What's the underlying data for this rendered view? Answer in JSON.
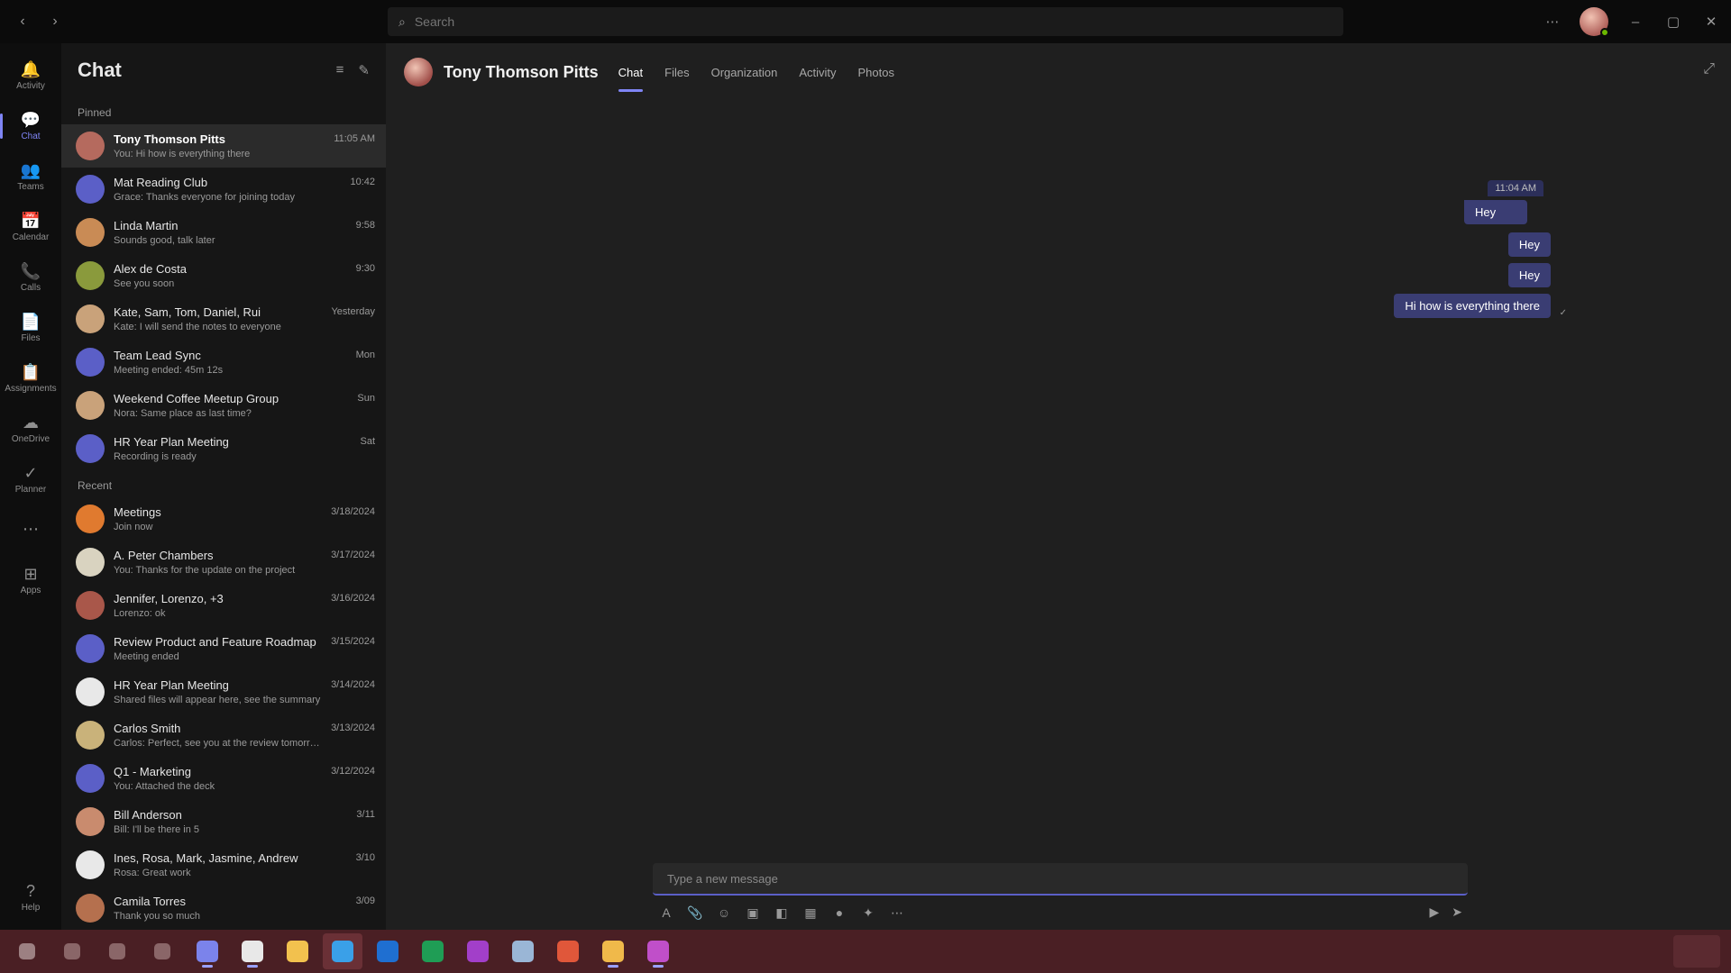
{
  "search": {
    "placeholder": "Search"
  },
  "rail": {
    "items": [
      {
        "name": "activity",
        "label": "Activity",
        "glyph": "🔔"
      },
      {
        "name": "chat",
        "label": "Chat",
        "glyph": "💬",
        "active": true
      },
      {
        "name": "teams",
        "label": "Teams",
        "glyph": "👥"
      },
      {
        "name": "calendar",
        "label": "Calendar",
        "glyph": "📅"
      },
      {
        "name": "calls",
        "label": "Calls",
        "glyph": "📞"
      },
      {
        "name": "files",
        "label": "Files",
        "glyph": "📄"
      },
      {
        "name": "assignments",
        "label": "Assignments",
        "glyph": "📋"
      },
      {
        "name": "onedrive",
        "label": "OneDrive",
        "glyph": "☁"
      },
      {
        "name": "planner",
        "label": "Planner",
        "glyph": "✓"
      },
      {
        "name": "more",
        "label": "",
        "glyph": "⋯"
      },
      {
        "name": "apps",
        "label": "Apps",
        "glyph": "⊞"
      }
    ],
    "help": {
      "label": "Help",
      "glyph": "?"
    }
  },
  "chatlist": {
    "title": "Chat",
    "pinned_label": "Pinned",
    "recent_label": "Recent",
    "pinned": [
      {
        "name": "Tony Thomson Pitts",
        "preview": "You: Hi how is everything there",
        "time": "11:05 AM",
        "color": "#b56a5e",
        "bold": true,
        "selected": true
      },
      {
        "name": "Mat Reading Club",
        "preview": "Grace: Thanks everyone for joining today",
        "time": "10:42",
        "color": "#5b5fc7",
        "bold": false
      },
      {
        "name": "Linda Martin",
        "preview": "Sounds good, talk later",
        "time": "9:58",
        "color": "#c98b55",
        "bold": false
      },
      {
        "name": "Alex de Costa",
        "preview": "See you soon",
        "time": "9:30",
        "color": "#8a9a3c",
        "bold": false
      },
      {
        "name": "Kate, Sam, Tom, Daniel, Rui",
        "preview": "Kate: I will send the notes to everyone",
        "time": "Yesterday",
        "color": "#c9a27a",
        "bold": false
      },
      {
        "name": "Team Lead Sync",
        "preview": "Meeting ended: 45m 12s",
        "time": "Mon",
        "color": "#5b5fc7",
        "bold": false
      },
      {
        "name": "Weekend Coffee Meetup Group",
        "preview": "Nora: Same place as last time?",
        "time": "Sun",
        "color": "#c9a27a",
        "bold": false
      },
      {
        "name": "HR Year Plan Meeting",
        "preview": "Recording is ready",
        "time": "Sat",
        "color": "#5b5fc7",
        "bold": false
      }
    ],
    "recent": [
      {
        "name": "Meetings",
        "preview": "Join now",
        "time": "3/18/2024",
        "color": "#e07a2f",
        "bold": false
      },
      {
        "name": "A. Peter Chambers",
        "preview": "You: Thanks for the update on the project",
        "time": "3/17/2024",
        "color": "#d9d3c0",
        "bold": false
      },
      {
        "name": "Jennifer, Lorenzo, +3",
        "preview": "Lorenzo: ok",
        "time": "3/16/2024",
        "color": "#a9574a",
        "bold": false
      },
      {
        "name": "Review Product and Feature Roadmap",
        "preview": "Meeting ended",
        "time": "3/15/2024",
        "color": "#5b5fc7",
        "bold": false
      },
      {
        "name": "HR Year Plan Meeting",
        "preview": "Shared files will appear here, see the summary",
        "time": "3/14/2024",
        "color": "#e8e8e8",
        "bold": false
      },
      {
        "name": "Carlos Smith",
        "preview": "Carlos: Perfect, see you at the review tomorrow",
        "time": "3/13/2024",
        "color": "#c9b27a",
        "bold": false
      },
      {
        "name": "Q1 - Marketing",
        "preview": "You: Attached the deck",
        "time": "3/12/2024",
        "color": "#5b5fc7",
        "bold": false
      },
      {
        "name": "Bill Anderson",
        "preview": "Bill: I'll be there in 5",
        "time": "3/11",
        "color": "#c98b6e",
        "bold": false
      },
      {
        "name": "Ines, Rosa, Mark, Jasmine, Andrew",
        "preview": "Rosa: Great work",
        "time": "3/10",
        "color": "#e8e8e8",
        "bold": false
      },
      {
        "name": "Camila Torres",
        "preview": "Thank you so much",
        "time": "3/09",
        "color": "#b5704e",
        "bold": false
      }
    ]
  },
  "conversation": {
    "name": "Tony Thomson Pitts",
    "tabs": [
      "Chat",
      "Files",
      "Organization",
      "Activity",
      "Photos"
    ],
    "active_tab": "Chat",
    "meta": "11:04 AM",
    "messages": [
      "Hey",
      "Hey",
      "Hey",
      "Hi how is everything there"
    ],
    "compose_placeholder": "Type a new message"
  },
  "taskbar": {
    "items": [
      {
        "name": "start",
        "color": "#e0d0d0"
      },
      {
        "name": "search",
        "color": "#c0a0a0"
      },
      {
        "name": "taskview",
        "color": "#c0a0a0"
      },
      {
        "name": "widgets",
        "color": "#c0a0a0"
      },
      {
        "name": "teams",
        "color": "#7b83eb",
        "open": true
      },
      {
        "name": "notepad",
        "color": "#e8e8e8",
        "open": true
      },
      {
        "name": "explorer",
        "color": "#f2c14e"
      },
      {
        "name": "edge",
        "color": "#3aa0e8",
        "active": true
      },
      {
        "name": "outlook",
        "color": "#1f6fd1"
      },
      {
        "name": "excel",
        "color": "#1f9d55"
      },
      {
        "name": "onenote",
        "color": "#a23fc9"
      },
      {
        "name": "photos",
        "color": "#9ab6d6"
      },
      {
        "name": "powerpoint",
        "color": "#e0573a"
      },
      {
        "name": "folder",
        "color": "#f0b94a",
        "open": true
      },
      {
        "name": "paint",
        "color": "#c04fc9",
        "open": true
      }
    ]
  }
}
